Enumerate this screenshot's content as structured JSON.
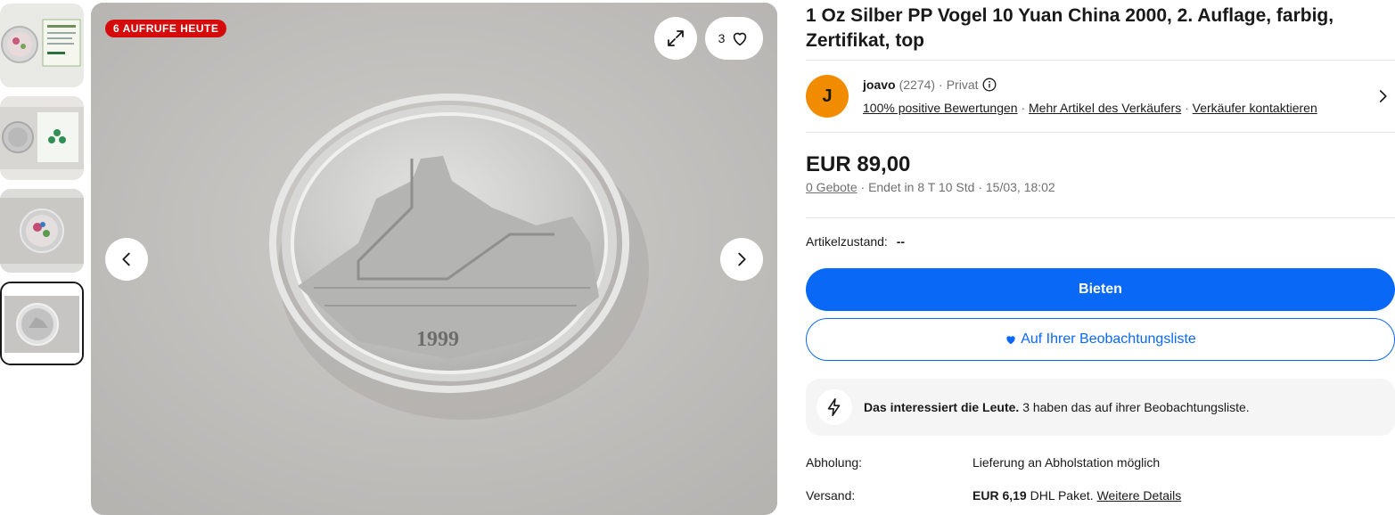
{
  "gallery": {
    "badge": "6 AUFRUFE HEUTE",
    "watch_count": "3",
    "coin_year": "1999",
    "thumbnails": [
      "coin-with-certificate",
      "coin-with-box",
      "colored-coin",
      "silver-coin-reverse"
    ],
    "selected_index": 3
  },
  "listing": {
    "title": "1 Oz Silber PP Vogel 10 Yuan China 2000, 2. Auflage, farbig, Zertifikat, top"
  },
  "seller": {
    "initial": "J",
    "name": "joavo",
    "count": "(2274)",
    "type": "Privat",
    "feedback_link": "100% positive Bewertungen",
    "more_items_link": "Mehr Artikel des Verkäufers",
    "contact_link": "Verkäufer kontaktieren",
    "separator": "·"
  },
  "price": {
    "amount": "EUR 89,00",
    "bids_link": "0 Gebote",
    "ends": "Endet in 8 T 10 Std",
    "end_date": "15/03, 18:02"
  },
  "condition": {
    "label": "Artikelzustand:",
    "value": "--"
  },
  "actions": {
    "bid_label": "Bieten",
    "watch_label": "Auf Ihrer Beobachtungsliste"
  },
  "interest": {
    "bold": "Das interessiert die Leute.",
    "text": "3 haben das auf ihrer Beobachtungsliste."
  },
  "details": {
    "pickup_label": "Abholung:",
    "pickup_value": "Lieferung an Abholstation möglich",
    "shipping_label": "Versand:",
    "shipping_price": "EUR 6,19",
    "shipping_method": "DHL Paket.",
    "shipping_link": "Weitere Details"
  },
  "colors": {
    "accent": "#0968f6",
    "badge": "#d50b0b",
    "avatar": "#f18b00"
  }
}
